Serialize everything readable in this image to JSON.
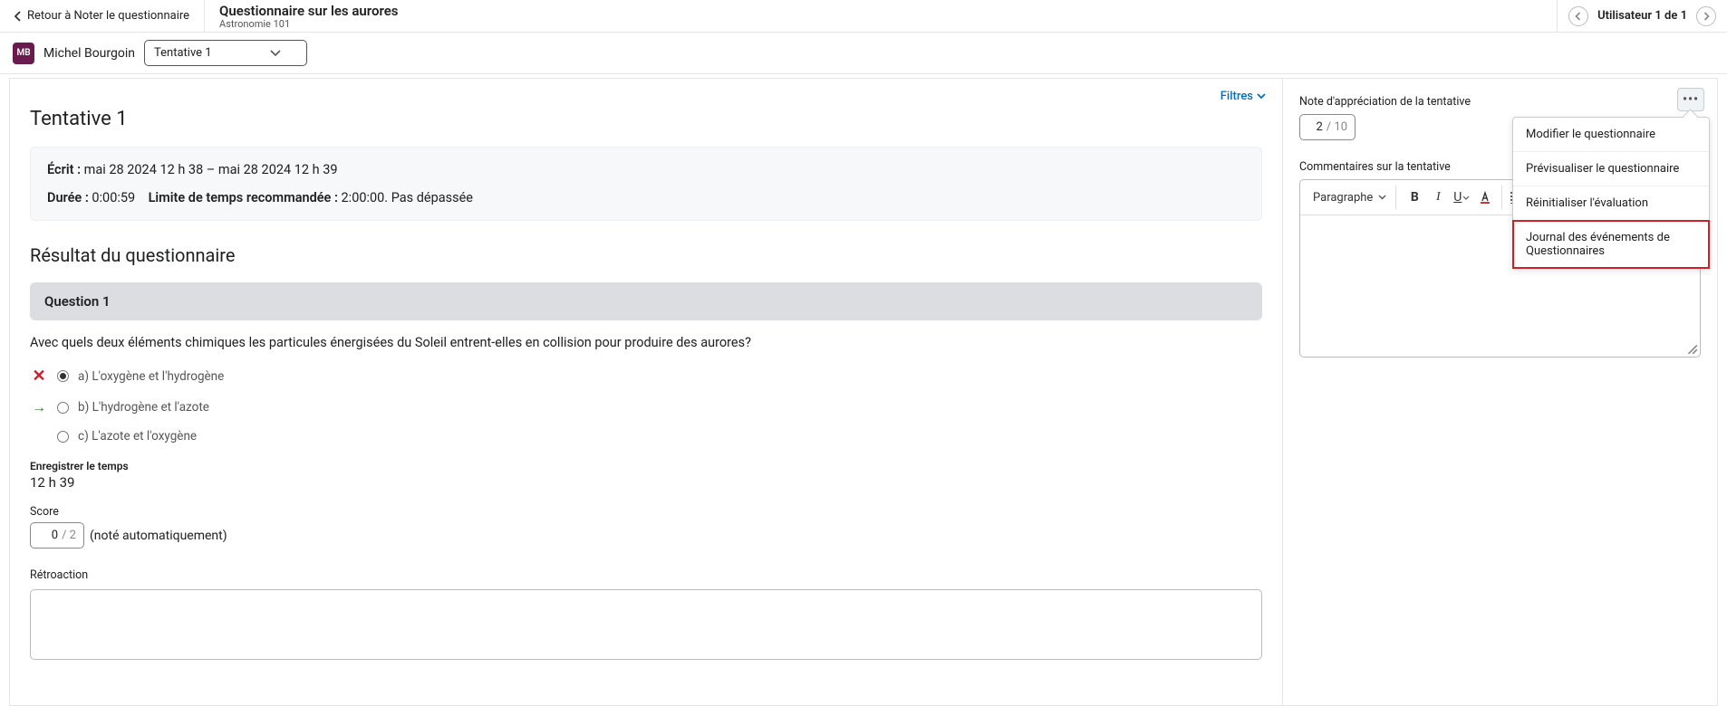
{
  "header": {
    "back_label": "Retour à Noter le questionnaire",
    "quiz_title": "Questionnaire sur les aurores",
    "course_name": "Astronomie 101",
    "user_count_prefix": "Utilisateur",
    "user_current": "1",
    "user_sep": "de",
    "user_total": "1"
  },
  "subbar": {
    "avatar_initials": "MB",
    "user_name": "Michel Bourgoin",
    "attempt_selected": "Tentative 1"
  },
  "left": {
    "filters_label": "Filtres",
    "attempt_heading": "Tentative 1",
    "info": {
      "ecrit_label": "Écrit :",
      "ecrit_value": "mai 28 2024 12 h 38 – mai 28 2024 12 h 39",
      "duree_label": "Durée :",
      "duree_value": "0:00:59",
      "limite_label": "Limite de temps recommandée :",
      "limite_value": "2:00:00. Pas dépassée"
    },
    "result_heading": "Résultat du questionnaire",
    "question_header": "Question 1",
    "question_text": "Avec quels deux éléments chimiques les particules énergisées du Soleil entrent-elles en collision pour produire des aurores?",
    "options": [
      {
        "mark": "x",
        "selected": true,
        "text": "a)  L'oxygène et l'hydrogène"
      },
      {
        "mark": "arrow",
        "selected": false,
        "text": "b)  L'hydrogène et l'azote"
      },
      {
        "mark": "",
        "selected": false,
        "text": "c)  L'azote et l'oxygène"
      }
    ],
    "save_time_label": "Enregistrer le temps",
    "save_time_value": "12 h 39",
    "score_label": "Score",
    "score_value": "0",
    "score_max": "/ 2",
    "auto_note": "(noté automatiquement)",
    "feedback_label": "Rétroaction"
  },
  "right": {
    "more_icon": "•••",
    "grade_label": "Note d'appréciation de la tentative",
    "grade_value": "2",
    "grade_max": "/ 10",
    "comments_label": "Commentaires sur la tentative",
    "toolbar": {
      "paragraph": "Paragraphe"
    },
    "menu": [
      "Modifier le questionnaire",
      "Prévisualiser le questionnaire",
      "Réinitialiser l'évaluation",
      "Journal des événements de Questionnaires"
    ]
  }
}
